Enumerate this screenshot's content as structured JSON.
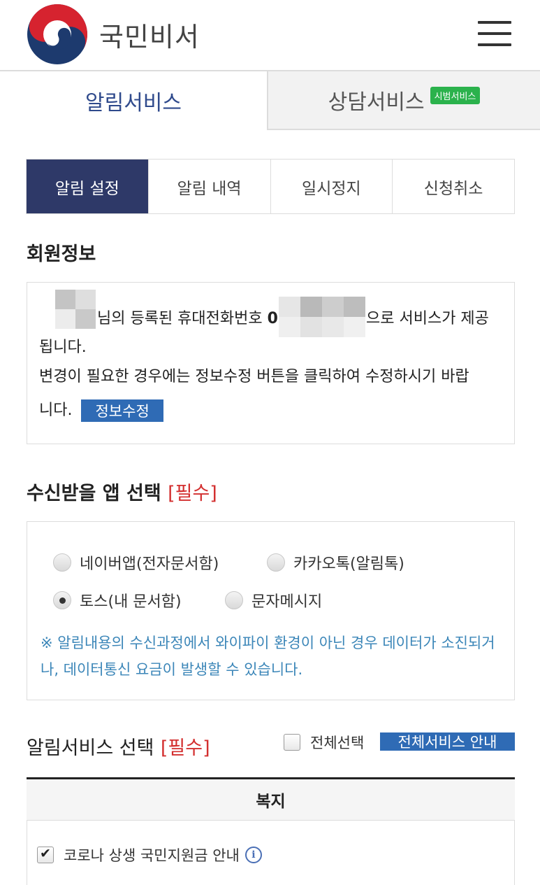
{
  "header": {
    "brand": "국민비서",
    "menu_icon": "hamburger-menu-icon",
    "logo_icon": "korea-government-logo-icon"
  },
  "top_tabs": [
    {
      "label": "알림서비스",
      "active": true
    },
    {
      "label": "상담서비스",
      "badge": "시범서비스",
      "active": false
    }
  ],
  "sub_tabs": [
    {
      "label": "알림 설정",
      "active": true
    },
    {
      "label": "알림 내역",
      "active": false
    },
    {
      "label": "일시정지",
      "active": false
    },
    {
      "label": "신청취소",
      "active": false
    }
  ],
  "member_info": {
    "title": "회원정보",
    "line1_a": "님의 등록된 휴대전화번호",
    "line1_b": "0",
    "line1_c": "으로 서비스가 제공",
    "line2": "됩니다.",
    "line3": "변경이 필요한 경우에는 정보수정 버튼을 클릭하여 수정하시기 바랍",
    "line4": "니다.",
    "edit_button": "정보수정"
  },
  "app_select": {
    "title": "수신받을 앱 선택",
    "required": "[필수]",
    "options": [
      {
        "label": "네이버앱(전자문서함)",
        "checked": false
      },
      {
        "label": "카카오톡(알림톡)",
        "checked": false
      },
      {
        "label": "토스(내 문서함)",
        "checked": true
      },
      {
        "label": "문자메시지",
        "checked": false
      }
    ],
    "notice": "※ 알림내용의 수신과정에서 와이파이 환경이 아닌 경우 데이터가 소진되거나, 데이터통신 요금이 발생할 수 있습니다."
  },
  "service_select": {
    "title": "알림서비스 선택",
    "required": "[필수]",
    "select_all": "전체선택",
    "guide_button": "전체서비스 안내",
    "category": "복지",
    "items": [
      {
        "label": "코로나 상생 국민지원금 안내",
        "checked": true
      }
    ]
  },
  "colors": {
    "primary_navy": "#2e3968",
    "tab_blue": "#2f4a8c",
    "button_blue": "#2f6bb5",
    "required_red": "#d32f2f",
    "notice_blue": "#3b86b8",
    "badge_green": "#2bb24c"
  }
}
